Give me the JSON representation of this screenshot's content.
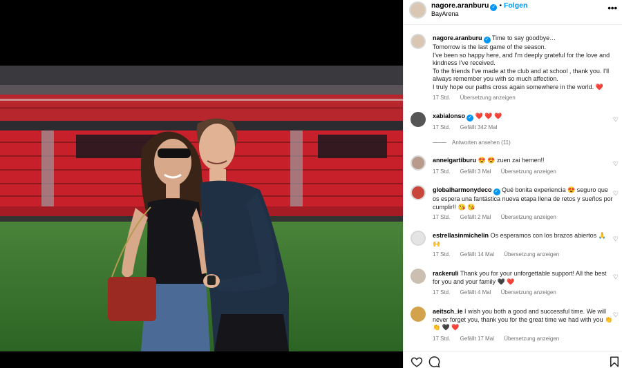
{
  "post": {
    "username": "nagore.aranburu",
    "follow_label": "Folgen",
    "location": "BayArena",
    "more_icon": "more-horizontal-icon",
    "caption_lines": [
      "Time to say goodbye…",
      "Tomorrow is the last game of the season.",
      "I've been so happy here, and I'm deeply grateful for the love and kindness I've received.",
      "To the friends I've made at the club and at school , thank you. I'll always remember you with so much affection.",
      "I truly hope our paths cross again somewhere in the world. ❤️"
    ],
    "caption_time": "17 Std.",
    "caption_translate": "Übersetzung anzeigen"
  },
  "comments": [
    {
      "user": "xabialonso",
      "verified": true,
      "text": "❤️ ❤️ ❤️",
      "time": "17 Std.",
      "likes": "Gefällt 342 Mal",
      "translate": "",
      "replies": "Antworten ansehen (11)"
    },
    {
      "user": "anneigartiburu",
      "verified": false,
      "text": "😍 😍 zuen zai hemen!!",
      "time": "17 Std.",
      "likes": "Gefällt 3 Mal",
      "translate": "Übersetzung anzeigen"
    },
    {
      "user": "globalharmonydeco",
      "verified": true,
      "text": "Qué bonita experiencia 😍 seguro que os espera una fantástica nueva etapa llena de retos y sueños por cumplir!! 😘 😘",
      "time": "17 Std.",
      "likes": "Gefällt 2 Mal",
      "translate": "Übersetzung anzeigen"
    },
    {
      "user": "estrellasinmichelin",
      "verified": false,
      "text": "Os esperamos con los brazos abiertos 🙏 🙌",
      "time": "17 Std.",
      "likes": "Gefällt 14 Mal",
      "translate": "Übersetzung anzeigen"
    },
    {
      "user": "rackeruli",
      "verified": false,
      "text": "Thank you for your unforgettable support! All the best for you and your family 🖤 ❤️",
      "time": "17 Std.",
      "likes": "Gefällt 4 Mal",
      "translate": "Übersetzung anzeigen"
    },
    {
      "user": "aeitsch_ie",
      "verified": false,
      "text": "I wish you both a good and successful time. We will never forget you, thank you for the great time we had with you 👏 👏 🖤 ❤️",
      "time": "17 Std.",
      "likes": "Gefällt 17 Mal",
      "translate": "Übersetzung anzeigen"
    }
  ],
  "actions": {
    "like_icon": "heart-icon",
    "comment_icon": "comment-icon",
    "save_icon": "bookmark-icon"
  },
  "colors": {
    "accent": "#0095f6",
    "muted": "#737373",
    "heart": "#e0245e",
    "stadium_red": "#c8202a",
    "pitch": "#3f7f35"
  }
}
